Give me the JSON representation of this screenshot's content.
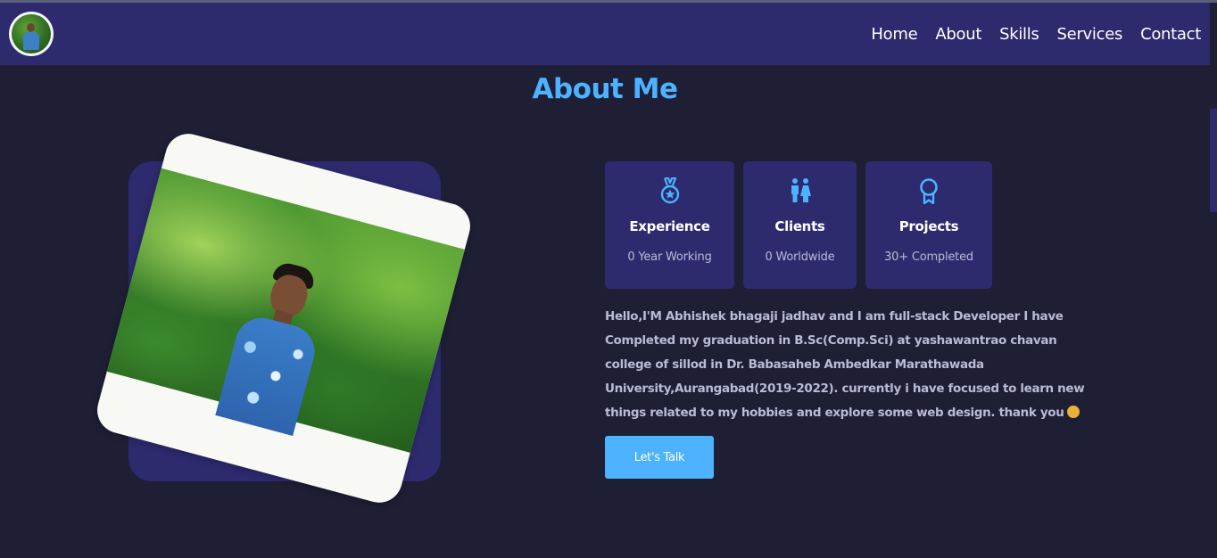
{
  "nav": {
    "links": [
      "Home",
      "About",
      "Skills",
      "Services",
      "Contact"
    ]
  },
  "about": {
    "title": "About Me",
    "stats": [
      {
        "icon": "medal-icon",
        "title": "Experience",
        "subtitle": "0 Year Working"
      },
      {
        "icon": "people-icon",
        "title": "Clients",
        "subtitle": "0 Worldwide"
      },
      {
        "icon": "award-ribbon-icon",
        "title": "Projects",
        "subtitle": "30+ Completed"
      }
    ],
    "description": "Hello,I'M Abhishek bhagaji jadhav and I am full-stack Developer I have Completed my graduation in B.Sc(Comp.Sci) at yashawantrao chavan college of sillod in Dr. Babasaheb Ambedkar Marathawada University,Aurangabad(2019-2022). currently i have focused to learn new things related to my hobbies and explore some web design. thank you",
    "cta_label": "Let's Talk"
  },
  "colors": {
    "background": "#1e1e35",
    "navbar": "#2d2a6e",
    "accent": "#4db2ff",
    "card": "#2d2a6e",
    "muted_text": "#b9bbd6"
  }
}
